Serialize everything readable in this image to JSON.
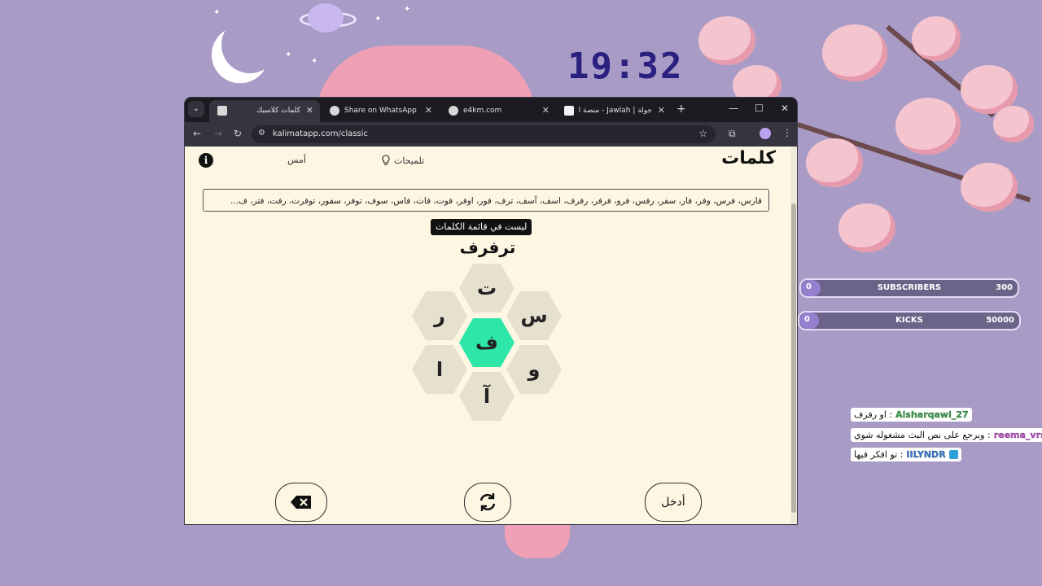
{
  "desktop": {
    "clock": "19:32"
  },
  "stream_widgets": {
    "bars": [
      {
        "current": "0",
        "label": "SUBSCRIBERS",
        "goal": "300"
      },
      {
        "current": "0",
        "label": "KICKS",
        "goal": "50000"
      }
    ],
    "chat": [
      {
        "user": "Alsharqawi_27",
        "message": "او رفرف",
        "user_color": "#3aa84b",
        "badge_color": ""
      },
      {
        "user": "reema_vrs99",
        "message": "وبرجع على نص البث مشغوله شوي",
        "user_color": "#c44fd1",
        "badge_color": "#e0a020"
      },
      {
        "user": "IILYNDR",
        "message": "تو افكر فيها",
        "user_color": "#3a7bd5",
        "badge_color": "#2ea0d8"
      }
    ]
  },
  "browser": {
    "tabs": [
      {
        "title": "كلمات كلاسيك",
        "active": true,
        "icon": "square-icon"
      },
      {
        "title": "Share on WhatsApp",
        "active": false,
        "icon": "globe-icon"
      },
      {
        "title": "e4km.com",
        "active": false,
        "icon": "globe-icon"
      },
      {
        "title": "جولة | Jawlah - منصة الألـ",
        "active": false,
        "icon": "jawlah-icon"
      }
    ],
    "url": "kalimatapp.com/classic"
  },
  "app": {
    "logo": "كلمات",
    "hints_label": "تلميحات",
    "yesterday_label": "أمس",
    "found_words": "فارس، فرس، وفر، فار، سفر، رفس، فرو، فرفر، رفرف، اسف، آسف، ترف، فور، اوفر، فوت، فات، فاس، سوف، توفر، سفور، توفرت، رفت، فتر، ف...",
    "toast": "ليست في قائمة الكلمات",
    "current_word": "ترفرف",
    "letters": {
      "top": "ت",
      "upper_left": "ر",
      "upper_right": "س",
      "center": "ف",
      "lower_left": "ا",
      "lower_right": "و",
      "bottom": "آ"
    },
    "enter_label": "أدخل"
  },
  "colors": {
    "center_hex": "#2ee6a8",
    "outer_hex": "#e6e0cf",
    "page_bg": "#fdf6e3",
    "desktop_bg": "#a89bc5"
  }
}
